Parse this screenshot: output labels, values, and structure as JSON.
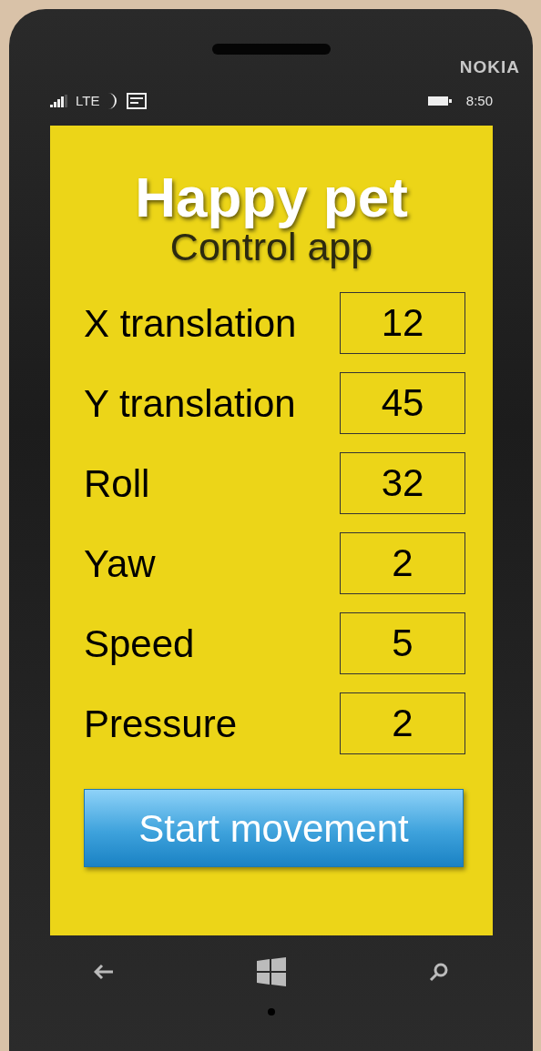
{
  "brand": "NOKIA",
  "status_bar": {
    "network": "LTE",
    "time": "8:50"
  },
  "title": "Happy pet",
  "subtitle": "Control app",
  "fields": [
    {
      "label": "X translation",
      "value": "12"
    },
    {
      "label": "Y translation",
      "value": "45"
    },
    {
      "label": "Roll",
      "value": "32"
    },
    {
      "label": "Yaw",
      "value": "2"
    },
    {
      "label": "Speed",
      "value": "5"
    },
    {
      "label": "Pressure",
      "value": "2"
    }
  ],
  "button": "Start movement"
}
